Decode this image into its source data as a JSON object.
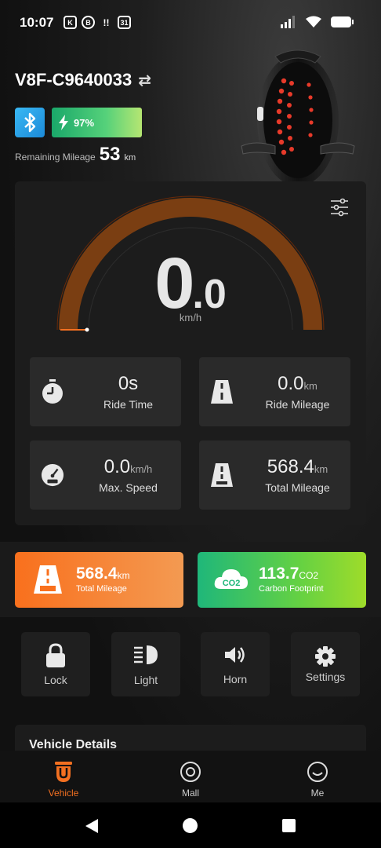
{
  "status_bar": {
    "time": "10:07",
    "notification_icons": [
      "K",
      "B",
      "!!",
      "31"
    ]
  },
  "device": {
    "name": "V8F-C9640033",
    "battery_percent": "97%",
    "battery_level": 0.97,
    "remaining_label": "Remaining Mileage",
    "remaining_value": "53",
    "remaining_unit": "km"
  },
  "speedometer": {
    "speed_int": "0",
    "speed_dec": ".0",
    "unit": "km/h"
  },
  "stats": [
    {
      "value": "0s",
      "unit": "",
      "label": "Ride Time"
    },
    {
      "value": "0.0",
      "unit": "km",
      "label": "Ride Mileage"
    },
    {
      "value": "0.0",
      "unit": "km/h",
      "label": "Max. Speed"
    },
    {
      "value": "568.4",
      "unit": "km",
      "label": "Total Mileage"
    }
  ],
  "summary_cards": {
    "mileage": {
      "value": "568.4",
      "unit": "km",
      "label": "Total Mileage",
      "icon_text": "ODO"
    },
    "carbon": {
      "value": "113.7",
      "unit": "CO2",
      "label": "Carbon Footprint",
      "icon_text": "CO2"
    }
  },
  "controls": [
    {
      "label": "Lock",
      "icon": "lock-icon"
    },
    {
      "label": "Light",
      "icon": "headlight-icon"
    },
    {
      "label": "Horn",
      "icon": "speaker-icon"
    },
    {
      "label": "Settings",
      "icon": "gear-icon"
    }
  ],
  "vehicle_details": {
    "label": "Vehicle Details"
  },
  "bottom_nav": [
    {
      "label": "Vehicle",
      "icon": "vehicle-icon",
      "active": true
    },
    {
      "label": "Mall",
      "icon": "mall-icon",
      "active": false
    },
    {
      "label": "Me",
      "icon": "smiley-icon",
      "active": false
    }
  ],
  "colors": {
    "accent": "#f37021",
    "gauge_arc": "#7a3e12",
    "bluetooth": "#2ba0e8",
    "battery_green": "#55d17a"
  }
}
